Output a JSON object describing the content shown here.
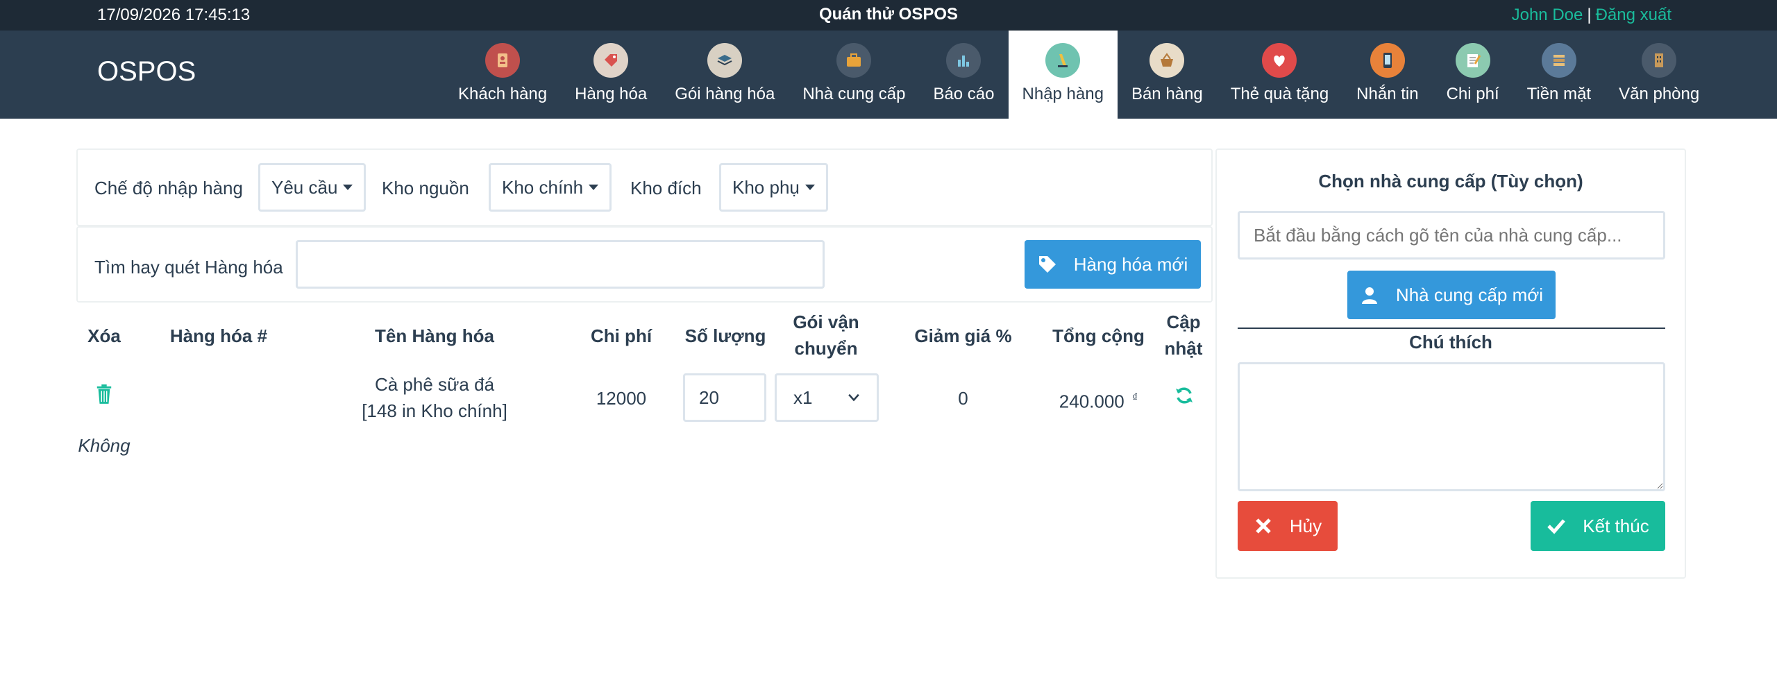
{
  "topbar": {
    "datetime": "17/09/2026 17:45:13",
    "title": "Quán thử OSPOS",
    "user": "John Doe",
    "separator": "|",
    "logout": "Đăng xuất"
  },
  "brand": "OSPOS",
  "nav": [
    {
      "label": "Khách hàng",
      "icon": "customers-icon",
      "color": "#c0504d"
    },
    {
      "label": "Hàng hóa",
      "icon": "items-icon",
      "color": "#e0d3c8"
    },
    {
      "label": "Gói hàng hóa",
      "icon": "item-kits-icon",
      "color": "#d8d0c3"
    },
    {
      "label": "Nhà cung cấp",
      "icon": "suppliers-icon",
      "color": "#4a5a6b"
    },
    {
      "label": "Báo cáo",
      "icon": "reports-icon",
      "color": "#4a5a6b"
    },
    {
      "label": "Nhập hàng",
      "icon": "receivings-icon",
      "color": "#6fc3b0"
    },
    {
      "label": "Bán hàng",
      "icon": "sales-icon",
      "color": "#e8dcc8"
    },
    {
      "label": "Thẻ quà tặng",
      "icon": "giftcards-icon",
      "color": "#e04a4a"
    },
    {
      "label": "Nhắn tin",
      "icon": "messages-icon",
      "color": "#e8823a"
    },
    {
      "label": "Chi phí",
      "icon": "expenses-icon",
      "color": "#8ccab0"
    },
    {
      "label": "Tiền mặt",
      "icon": "cashups-icon",
      "color": "#5b7a99"
    },
    {
      "label": "Văn phòng",
      "icon": "office-icon",
      "color": "#4a5a6b"
    }
  ],
  "mode_panel": {
    "mode_label": "Chế độ nhập hàng",
    "mode_value": "Yêu cầu",
    "source_label": "Kho nguồn",
    "source_value": "Kho chính",
    "dest_label": "Kho đích",
    "dest_value": "Kho phụ"
  },
  "search_panel": {
    "label": "Tìm hay quét Hàng hóa",
    "value": "",
    "new_item_button": "Hàng hóa mới"
  },
  "table": {
    "headers": {
      "delete": "Xóa",
      "item_number": "Hàng hóa #",
      "item_name": "Tên Hàng hóa",
      "cost": "Chi phí",
      "quantity": "Số lượng",
      "ship_pack_1": "Gói vận",
      "ship_pack_2": "chuyển",
      "discount": "Giảm giá %",
      "total": "Tổng cộng",
      "update_1": "Cập",
      "update_2": "nhật"
    },
    "rows": [
      {
        "item_number": "",
        "name_line1": "Cà phê sữa đá",
        "name_line2": "[148 in Kho chính]",
        "cost": "12000",
        "quantity": "20",
        "ship_pack": "x1",
        "discount": "0",
        "total": "240.000",
        "currency": "₫",
        "note": "Không"
      }
    ]
  },
  "sidebar": {
    "supplier_title": "Chọn nhà cung cấp (Tùy chọn)",
    "supplier_placeholder": "Bắt đầu bằng cách gõ tên của nhà cung cấp...",
    "new_supplier_button": "Nhà cung cấp mới",
    "comment_label": "Chú thích",
    "comment_value": "",
    "cancel_button": "Hủy",
    "finish_button": "Kết thúc"
  }
}
